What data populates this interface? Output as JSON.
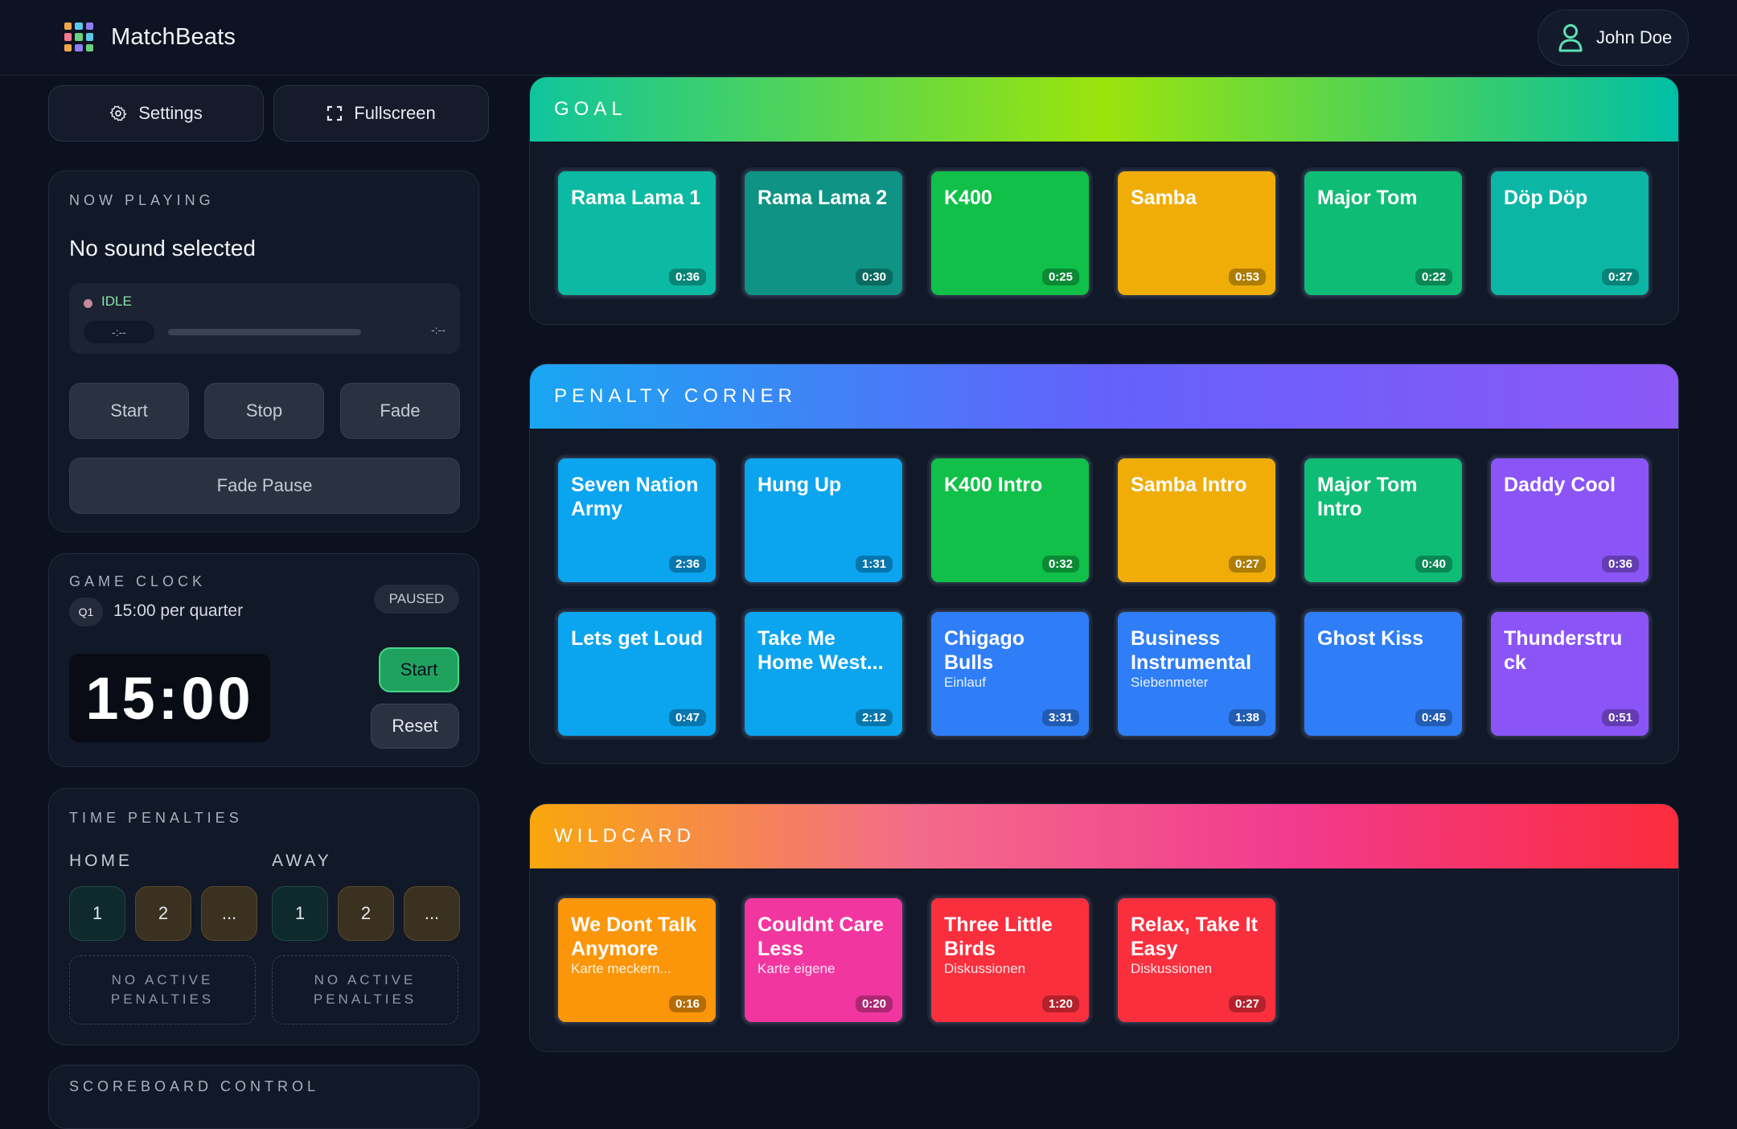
{
  "app": {
    "title": "MatchBeats"
  },
  "user": {
    "name": "John Doe"
  },
  "toolbar": {
    "settings_label": "Settings",
    "fullscreen_label": "Fullscreen"
  },
  "now_playing": {
    "heading": "NOW PLAYING",
    "title": "No sound selected",
    "status": "IDLE",
    "elapsed": "-:--",
    "remaining": "-:--",
    "progress": 0,
    "buttons": {
      "start": "Start",
      "stop": "Stop",
      "fade": "Fade",
      "fade_pause": "Fade Pause"
    }
  },
  "game_clock": {
    "heading": "GAME CLOCK",
    "quarter": "Q1",
    "quarter_length": "15:00 per quarter",
    "state": "PAUSED",
    "time": "15:00",
    "start_label": "Start",
    "reset_label": "Reset"
  },
  "penalties": {
    "heading": "TIME PENALTIES",
    "home_label": "HOME",
    "away_label": "AWAY",
    "home_buttons": [
      "1",
      "2",
      "..."
    ],
    "away_buttons": [
      "1",
      "2",
      "..."
    ],
    "home_empty": "NO ACTIVE PENALTIES",
    "away_empty": "NO ACTIVE PENALTIES"
  },
  "scoreboard": {
    "heading": "SCOREBOARD CONTROL"
  },
  "categories": [
    {
      "name": "GOAL",
      "gradient": [
        "#0fc59d",
        "#9be40b",
        "#00bfa5"
      ],
      "tiles": [
        {
          "title": "Rama Lama 1",
          "duration": "0:36",
          "color": "#0cb9a2"
        },
        {
          "title": "Rama Lama 2",
          "duration": "0:30",
          "color": "#0e9384"
        },
        {
          "title": "K400",
          "duration": "0:25",
          "color": "#10c048"
        },
        {
          "title": "Samba",
          "duration": "0:53",
          "color": "#f0ad08"
        },
        {
          "title": "Major Tom",
          "duration": "0:22",
          "color": "#0fbc75"
        },
        {
          "title": "Döp Döp",
          "duration": "0:27",
          "color": "#0cb6a5"
        }
      ]
    },
    {
      "name": "PENALTY CORNER",
      "gradient": [
        "#19a6f2",
        "#6461fb",
        "#8c58f6"
      ],
      "tiles": [
        {
          "title": "Seven Nation Army",
          "duration": "2:36",
          "color": "#0ba4ef"
        },
        {
          "title": "Hung Up",
          "duration": "1:31",
          "color": "#0ba4ef"
        },
        {
          "title": "K400 Intro",
          "duration": "0:32",
          "color": "#10c048"
        },
        {
          "title": "Samba Intro",
          "duration": "0:27",
          "color": "#f0ad08"
        },
        {
          "title": "Major Tom Intro",
          "duration": "0:40",
          "color": "#0fbc75"
        },
        {
          "title": "Daddy Cool",
          "duration": "0:36",
          "color": "#8b54f7"
        },
        {
          "title": "Lets get Loud",
          "duration": "0:47",
          "color": "#0ba4ef"
        },
        {
          "title": "Take Me Home West...",
          "duration": "2:12",
          "color": "#0ba4ef"
        },
        {
          "title": "Chigago Bulls",
          "subtitle": "Einlauf",
          "duration": "3:31",
          "color": "#2f7ef7"
        },
        {
          "title": "Business Instrumental",
          "subtitle": "Siebenmeter",
          "duration": "1:38",
          "color": "#2f7ef7"
        },
        {
          "title": "Ghost Kiss",
          "duration": "0:45",
          "color": "#2f7ef7"
        },
        {
          "title": "Thunderstru ck",
          "duration": "0:51",
          "color": "#8b54f7"
        }
      ]
    },
    {
      "name": "WILDCARD",
      "gradient": [
        "#f9a70c",
        "#f36b8a",
        "#f23a8e",
        "#fa2c3c"
      ],
      "tiles": [
        {
          "title": "We Dont Talk Anymore",
          "subtitle": "Karte meckern...",
          "duration": "0:16",
          "color": "#fb960b"
        },
        {
          "title": "Couldnt Care Less",
          "subtitle": "Karte eigene",
          "duration": "0:20",
          "color": "#f236a0"
        },
        {
          "title": "Three Little Birds",
          "subtitle": "Diskussionen",
          "duration": "1:20",
          "color": "#fa2f3e"
        },
        {
          "title": "Relax, Take It Easy",
          "subtitle": "Diskussionen",
          "duration": "0:27",
          "color": "#fa2f3e"
        }
      ]
    }
  ]
}
